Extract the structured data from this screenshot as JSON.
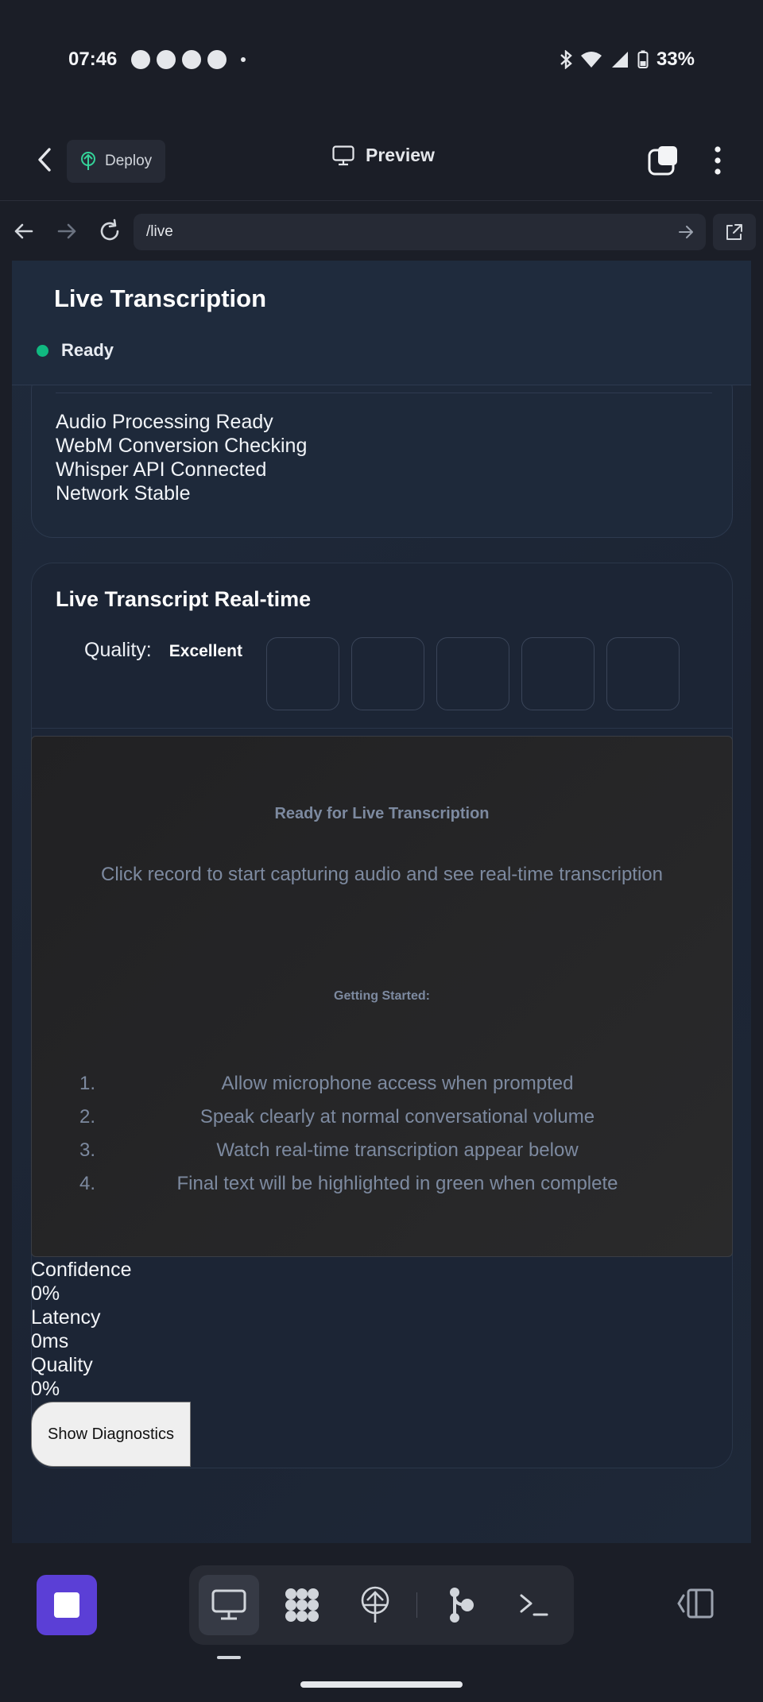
{
  "status_bar": {
    "time": "07:46",
    "battery": "33%"
  },
  "app_header": {
    "deploy_label": "Deploy",
    "preview_label": "Preview"
  },
  "url_bar": {
    "value": "/live"
  },
  "page": {
    "title": "Live Transcription",
    "status": "Ready",
    "status_color": "#10b981",
    "system_status": [
      "Audio Processing Ready",
      "WebM Conversion Checking",
      "Whisper API Connected",
      "Network Stable"
    ],
    "transcript": {
      "title": "Live Transcript Real-time",
      "quality_label": "Quality:",
      "quality_value": "Excellent",
      "empty_title": "Ready for Live Transcription",
      "empty_subtitle": "Click record to start capturing audio and see real-time transcription",
      "getting_started": "Getting Started:",
      "steps": [
        {
          "num": "1.",
          "text": "Allow microphone access when prompted"
        },
        {
          "num": "2.",
          "text": "Speak clearly at normal conversational volume"
        },
        {
          "num": "3.",
          "text": "Watch real-time transcription appear below"
        },
        {
          "num": "4.",
          "text": "Final text will be highlighted in green when complete"
        }
      ]
    },
    "metrics": {
      "confidence_label": "Confidence",
      "confidence_value": "0%",
      "latency_label": "Latency",
      "latency_value": "0ms",
      "quality_label": "Quality",
      "quality_value": "0%"
    },
    "diagnostics_button": "Show Diagnostics"
  },
  "dock": {
    "accent": "#5b3fd6",
    "tools": [
      "preview-icon",
      "apps-icon",
      "deploy-icon",
      "git-icon",
      "terminal-icon"
    ]
  }
}
